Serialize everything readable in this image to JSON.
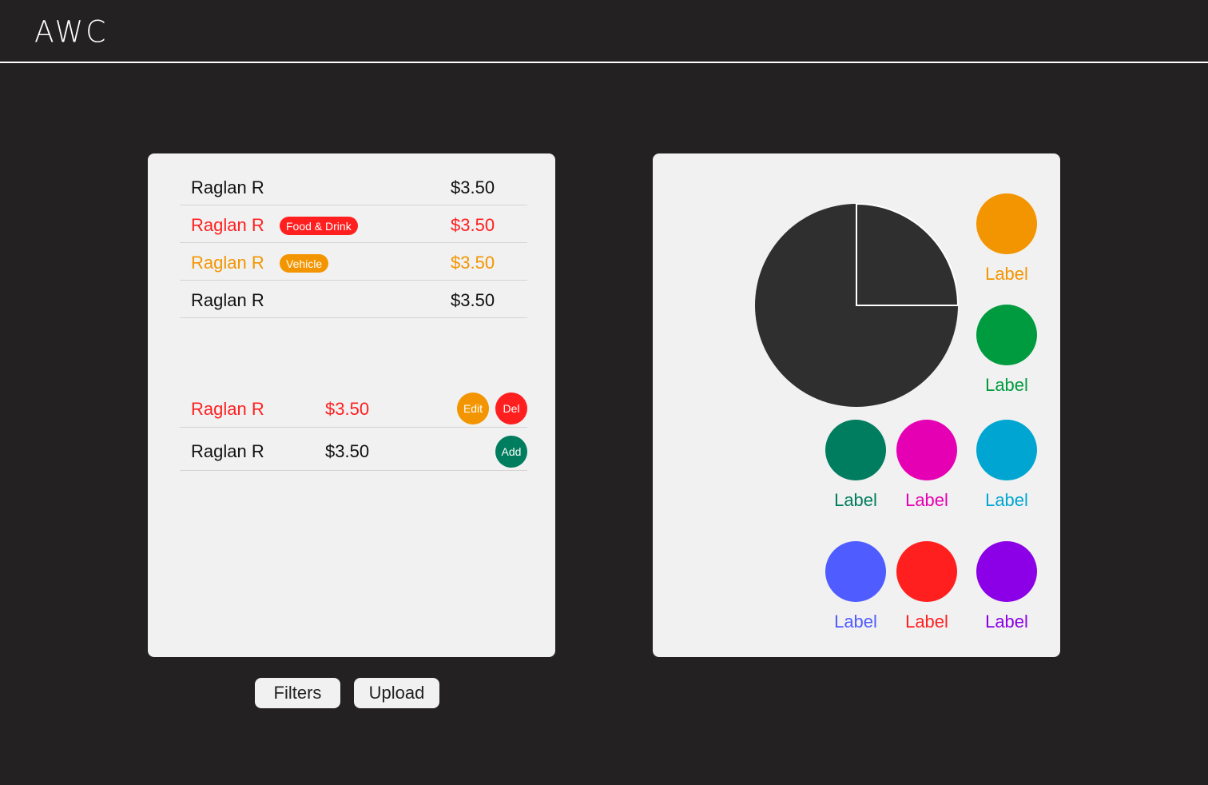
{
  "app": {
    "logo": "AWC"
  },
  "transactions": [
    {
      "name": "Raglan R",
      "amount": "$3.50",
      "color": "#111111",
      "tag": null
    },
    {
      "name": "Raglan R",
      "amount": "$3.50",
      "color": "#ff1f1f",
      "tag": {
        "label": "Food & Drink",
        "color": "#ff1f1f"
      }
    },
    {
      "name": "Raglan R",
      "amount": "$3.50",
      "color": "#f39500",
      "tag": {
        "label": "Vehicle",
        "color": "#f39500"
      }
    },
    {
      "name": "Raglan R",
      "amount": "$3.50",
      "color": "#111111",
      "tag": null
    }
  ],
  "editable_rows": [
    {
      "name": "Raglan R",
      "amount": "$3.50",
      "color": "#ff1f1f",
      "edit_label": "Edit",
      "delete_label": "Del"
    },
    {
      "name": "Raglan R",
      "amount": "$3.50",
      "color": "#111111",
      "add_label": "Add"
    }
  ],
  "actions": {
    "filters_label": "Filters",
    "upload_label": "Upload"
  },
  "colors": {
    "background": "#232122",
    "panel": "#f1f1f1",
    "pie": "#2f2f2f",
    "edit": "#f39500",
    "delete": "#ff1f1f",
    "add": "#007d5e"
  },
  "pie_chart": {
    "slices_fraction": [
      0.25,
      0.75
    ]
  },
  "legend": [
    {
      "label": "Label",
      "color": "#f39500"
    },
    {
      "label": "Label",
      "color": "#009b3f"
    },
    {
      "label": "Label",
      "color": "#007d5e"
    },
    {
      "label": "Label",
      "color": "#e600b4"
    },
    {
      "label": "Label",
      "color": "#00a6d1"
    },
    {
      "label": "Label",
      "color": "#4f5cff"
    },
    {
      "label": "Label",
      "color": "#ff1f1f"
    },
    {
      "label": "Label",
      "color": "#8b00e6"
    }
  ]
}
